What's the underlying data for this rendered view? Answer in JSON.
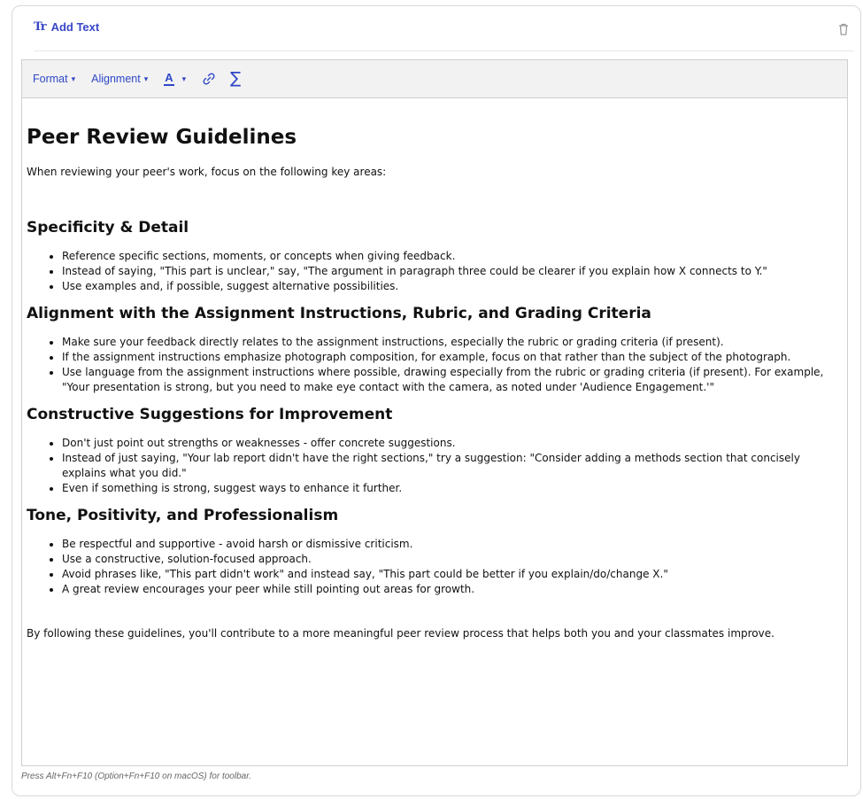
{
  "header": {
    "add_text_icon": "text-format-icon",
    "add_text_icon_glyph": "Tr",
    "add_text_label": "Add Text",
    "delete_icon": "trash-icon"
  },
  "toolbar": {
    "format_label": "Format",
    "alignment_label": "Alignment",
    "color_letter": "A",
    "link_icon": "link-icon",
    "equation_icon": "sigma-icon",
    "equation_glyph": "∑"
  },
  "document": {
    "title": "Peer Review Guidelines",
    "intro": "When reviewing your peer's work, focus on the following key areas:",
    "sections": [
      {
        "heading": "Specificity & Detail",
        "items": [
          "Reference specific sections, moments, or concepts when giving feedback.",
          "Instead of saying, \"This part is unclear,\" say, \"The argument in paragraph three could be clearer if you explain how X connects to Y.\"",
          "Use examples and, if possible, suggest alternative possibilities."
        ]
      },
      {
        "heading": "Alignment with the Assignment Instructions, Rubric, and Grading Criteria",
        "items": [
          "Make sure your feedback directly relates to the assignment instructions, especially the rubric or grading criteria (if present).",
          "If the assignment instructions emphasize photograph composition, for example, focus on that rather than the subject of the photograph.",
          "Use language from the assignment instructions where possible, drawing especially from the rubric or grading criteria (if present). For example, \"Your presentation is strong, but you need to make eye contact with the camera, as noted under 'Audience Engagement.'\""
        ]
      },
      {
        "heading": "Constructive Suggestions for Improvement",
        "items": [
          "Don't just point out strengths or weaknesses - offer concrete suggestions.",
          "Instead of just saying, \"Your lab report didn't have the right sections,\" try a suggestion: \"Consider adding a methods section that concisely explains what you did.\"",
          "Even if something is strong, suggest ways to enhance it further."
        ]
      },
      {
        "heading": "Tone, Positivity, and Professionalism",
        "items": [
          "Be respectful and supportive - avoid harsh or dismissive criticism.",
          "Use a constructive, solution-focused approach.",
          "Avoid phrases like, \"This part didn't work\" and instead say, \"This part could be better if you explain/do/change X.\"",
          "A great review encourages your peer while still pointing out areas for growth."
        ]
      }
    ],
    "closing": "By following these guidelines, you'll contribute to a more meaningful peer review process that helps both you and your classmates improve."
  },
  "footer_hint": "Press Alt+Fn+F10 (Option+Fn+F10 on macOS) for toolbar."
}
